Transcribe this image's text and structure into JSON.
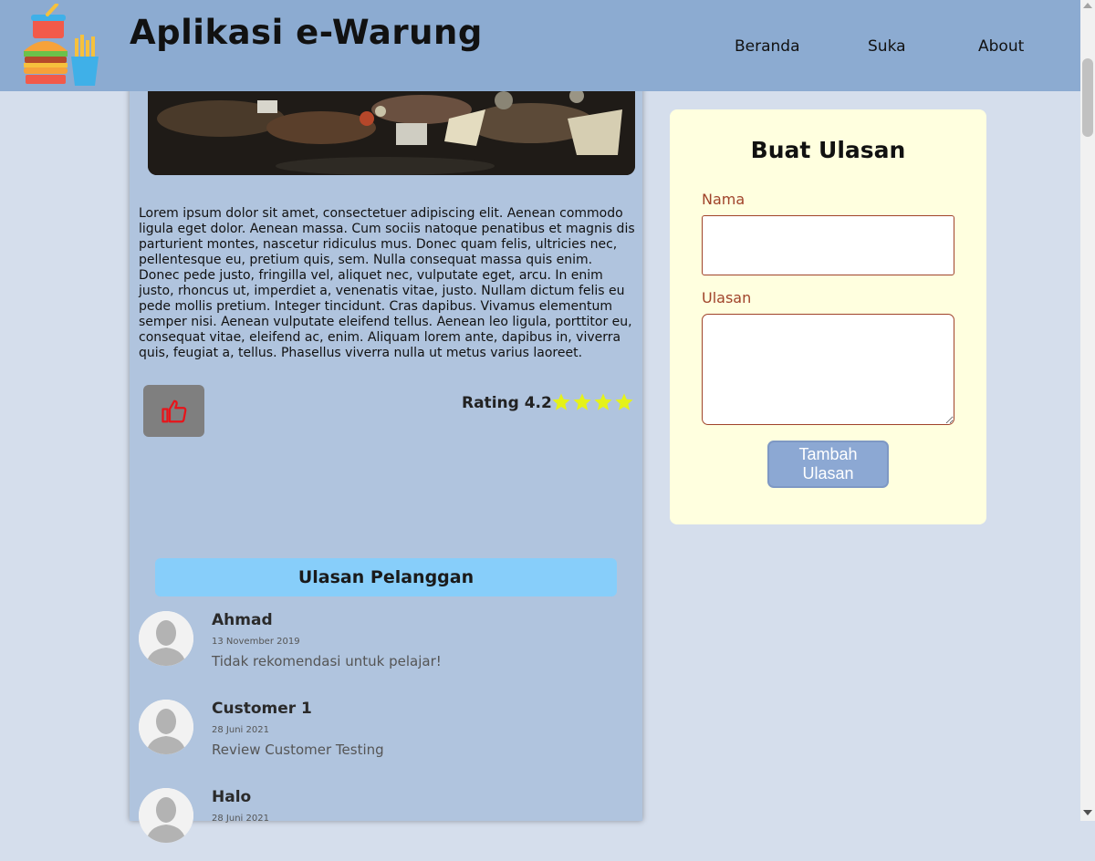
{
  "header": {
    "title": "Aplikasi e-Warung",
    "nav": [
      {
        "label": "Beranda"
      },
      {
        "label": "Suka"
      },
      {
        "label": "About"
      }
    ]
  },
  "detail": {
    "description": "Lorem ipsum dolor sit amet, consectetuer adipiscing elit. Aenean commodo ligula eget dolor. Aenean massa. Cum sociis natoque penatibus et magnis dis parturient montes, nascetur ridiculus mus. Donec quam felis, ultricies nec, pellentesque eu, pretium quis, sem. Nulla consequat massa quis enim. Donec pede justo, fringilla vel, aliquet nec, vulputate eget, arcu. In enim justo, rhoncus ut, imperdiet a, venenatis vitae, justo. Nullam dictum felis eu pede mollis pretium. Integer tincidunt. Cras dapibus. Vivamus elementum semper nisi. Aenean vulputate eleifend tellus. Aenean leo ligula, porttitor eu, consequat vitae, eleifend ac, enim. Aliquam lorem ante, dapibus in, viverra quis, feugiat a, tellus. Phasellus viverra nulla ut metus varius laoreet.",
    "rating_label": "Rating 4.2",
    "stars_shown": 4,
    "star_color": "#e5f218",
    "like_icon": "thumbs-up-icon",
    "like_icon_color": "#e8141a"
  },
  "reviews": {
    "title": "Ulasan Pelanggan",
    "items": [
      {
        "name": "Ahmad",
        "date": "13 November 2019",
        "text": "Tidak rekomendasi untuk pelajar!"
      },
      {
        "name": "Customer 1",
        "date": "28 Juni 2021",
        "text": "Review Customer Testing"
      },
      {
        "name": "Halo",
        "date": "28 Juni 2021",
        "text": ""
      }
    ]
  },
  "form": {
    "title": "Buat Ulasan",
    "name_label": "Nama",
    "name_value": "",
    "review_label": "Ulasan",
    "review_value": "",
    "submit_label": "Tambah Ulasan"
  },
  "colors": {
    "header_bg": "#8cabd1",
    "page_bg": "#d5deec",
    "main_bg": "#b0c4de",
    "form_bg": "#ffffdf",
    "reviews_title_bg": "#87cefa",
    "label_color": "#a0432a",
    "button_bg": "#8ca8d3"
  }
}
